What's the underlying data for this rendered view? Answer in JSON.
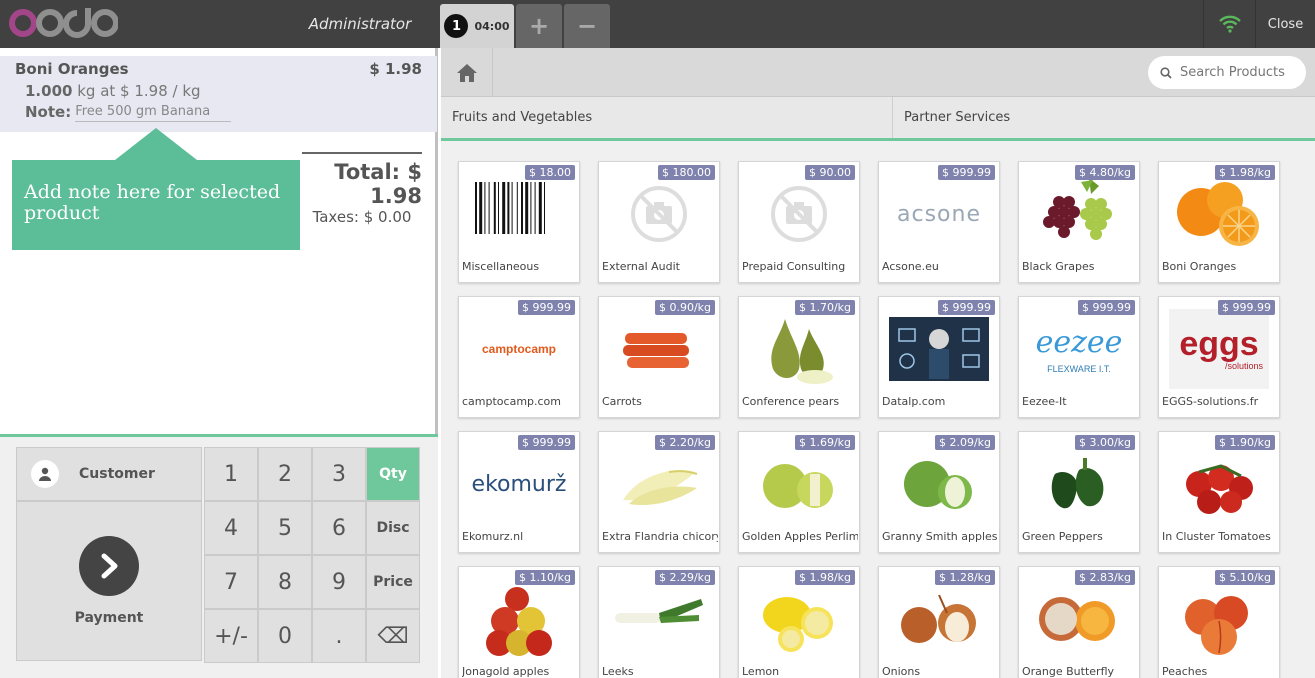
{
  "header": {
    "logo_text": "odoo",
    "cashier": "Administrator",
    "order_number": "1",
    "order_time": "04:00",
    "add_label": "+",
    "remove_label": "−",
    "close_label": "Close"
  },
  "order": {
    "line": {
      "product": "Boni Oranges",
      "price": "$ 1.98",
      "quantity": "1.000",
      "unit_info": "kg at $ 1.98 / kg",
      "note_label": "Note:",
      "note_value": "Free 500 gm Banana"
    },
    "tooltip": "Add note here for selected product",
    "total": "Total: $ 1.98",
    "taxes": "Taxes: $ 0.00"
  },
  "controls": {
    "customer": "Customer",
    "payment": "Payment",
    "keys": [
      "1",
      "2",
      "3",
      "Qty",
      "4",
      "5",
      "6",
      "Disc",
      "7",
      "8",
      "9",
      "Price",
      "+/-",
      "0",
      ".",
      "⌫"
    ]
  },
  "search": {
    "placeholder": "Search Products"
  },
  "categories": [
    "Fruits and Vegetables",
    "Partner Services"
  ],
  "products": [
    {
      "name": "Miscellaneous",
      "price": "$ 18.00",
      "icon": "barcode-image"
    },
    {
      "name": "External Audit",
      "price": "$ 180.00",
      "icon": "no-image-icon"
    },
    {
      "name": "Prepaid Consulting",
      "price": "$ 90.00",
      "icon": "no-image-icon"
    },
    {
      "name": "Acsone.eu",
      "price": "$ 999.99",
      "icon": "acsone-logo",
      "logo_text": "acsone"
    },
    {
      "name": "Black Grapes",
      "price": "$ 4.80/kg",
      "icon": "grapes-image"
    },
    {
      "name": "Boni Oranges",
      "price": "$ 1.98/kg",
      "icon": "oranges-image"
    },
    {
      "name": "camptocamp.com",
      "price": "$ 999.99",
      "icon": "camptocamp-logo",
      "logo_text": "camptocamp"
    },
    {
      "name": "Carrots",
      "price": "$ 0.90/kg",
      "icon": "carrots-image"
    },
    {
      "name": "Conference pears",
      "price": "$ 1.70/kg",
      "icon": "pears-image"
    },
    {
      "name": "Datalp.com",
      "price": "$ 999.99",
      "icon": "datalp-image"
    },
    {
      "name": "Eezee-It",
      "price": "$ 999.99",
      "icon": "eezee-logo",
      "logo_text": "eezee",
      "logo_sub": "FLEXWARE I.T."
    },
    {
      "name": "EGGS-solutions.fr",
      "price": "$ 999.99",
      "icon": "eggs-logo",
      "logo_text": "eggs",
      "logo_sub": "/solutions"
    },
    {
      "name": "Ekomurz.nl",
      "price": "$ 999.99",
      "icon": "ekomurz-logo",
      "logo_text": "ekomurž"
    },
    {
      "name": "Extra Flandria chicory",
      "price": "$ 2.20/kg",
      "icon": "chicory-image"
    },
    {
      "name": "Golden Apples Perlim",
      "price": "$ 1.69/kg",
      "icon": "golden-apples-image"
    },
    {
      "name": "Granny Smith apples",
      "price": "$ 2.09/kg",
      "icon": "green-apples-image"
    },
    {
      "name": "Green Peppers",
      "price": "$ 3.00/kg",
      "icon": "peppers-image"
    },
    {
      "name": "In Cluster Tomatoes",
      "price": "$ 1.90/kg",
      "icon": "tomatoes-image"
    },
    {
      "name": "Jonagold apples",
      "price": "$ 1.10/kg",
      "icon": "red-apples-image"
    },
    {
      "name": "Leeks",
      "price": "$ 2.29/kg",
      "icon": "leeks-image"
    },
    {
      "name": "Lemon",
      "price": "$ 1.98/kg",
      "icon": "lemon-image"
    },
    {
      "name": "Onions",
      "price": "$ 1.28/kg",
      "icon": "onions-image"
    },
    {
      "name": "Orange Butterfly",
      "price": "$ 2.83/kg",
      "icon": "orange-butterfly-image"
    },
    {
      "name": "Peaches",
      "price": "$ 5.10/kg",
      "icon": "peaches-image"
    }
  ],
  "colors": {
    "accent": "#6ec89b",
    "price_tag": "#7f82ac",
    "topbar": "#414141",
    "tooltip": "#5cbd99",
    "wifi": "#5cb85c"
  }
}
